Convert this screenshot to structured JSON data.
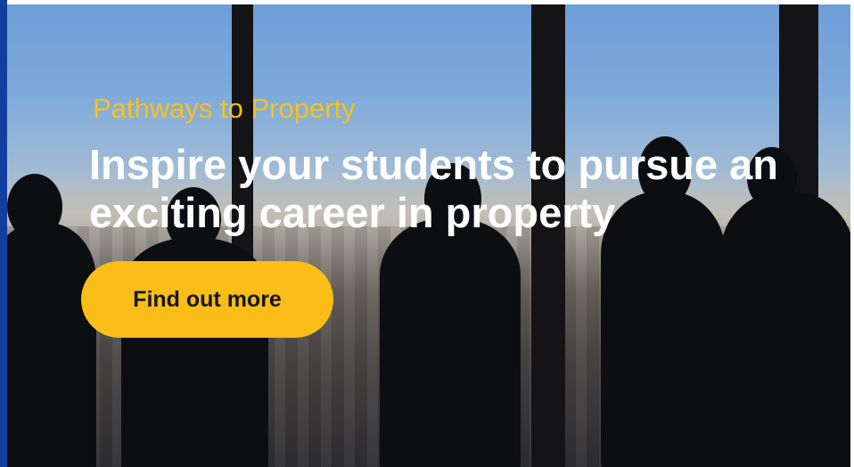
{
  "hero": {
    "eyebrow": "Pathways to Property",
    "headline": "Inspire your students to pursue an exciting career in property",
    "cta_label": "Find out more"
  },
  "colors": {
    "eyebrow": "#f6c21c",
    "cta_background": "#fbbd18",
    "headline": "#ffffff",
    "left_edge": "#123f9e"
  }
}
